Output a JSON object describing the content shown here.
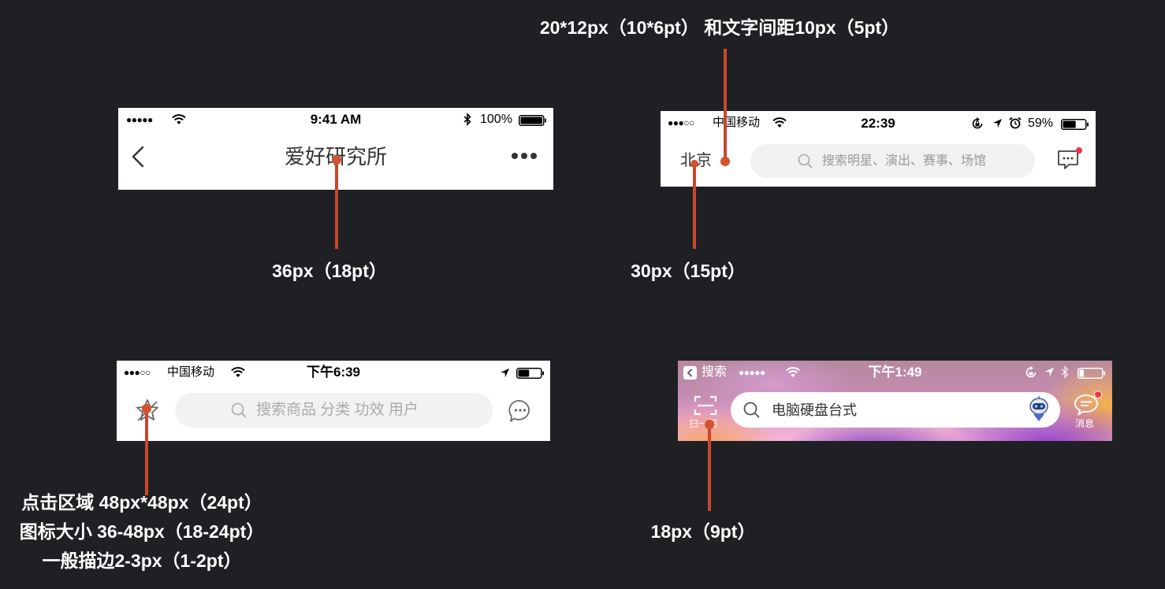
{
  "colors": {
    "background": "#1f2023",
    "annotation": "#c9472d",
    "unread_dot": "#f2334b"
  },
  "annotations": {
    "bar1_title": "36px（18pt）",
    "bar2_top": "20*12px（10*6pt） 和文字间距10px（5pt）",
    "bar2_bottom": "30px（15pt）",
    "bar3_lines": [
      "点击区域 48px*48px（24pt）",
      "图标大小 36-48px（18-24pt）",
      "一般描边2-3px（1-2pt）"
    ],
    "bar4_bottom": "18px（9pt）"
  },
  "bar1": {
    "status": {
      "signal": "●●●●●",
      "time": "9:41 AM",
      "battery_text": "100%",
      "battery_level": 1.0
    },
    "nav": {
      "title": "爱好研究所"
    },
    "icons": [
      "wifi-icon",
      "bluetooth-icon",
      "battery-icon",
      "back-chevron-icon",
      "more-icon"
    ]
  },
  "bar2": {
    "status": {
      "signal": "●●●○○",
      "carrier": "中国移动",
      "time": "22:39",
      "battery_text": "59%",
      "battery_level": 0.59
    },
    "nav": {
      "city": "北京",
      "search_placeholder": "搜索明星、演出、赛事、场馆"
    },
    "icons": [
      "wifi-icon",
      "rotation-lock-icon",
      "location-icon",
      "alarm-icon",
      "battery-icon",
      "search-icon",
      "message-icon"
    ]
  },
  "bar3": {
    "status": {
      "signal": "●●●○○",
      "carrier": "中国移动",
      "time": "下午6:39",
      "battery_level": 0.5
    },
    "nav": {
      "search_placeholder": "搜索商品 分类 功效 用户"
    },
    "icons": [
      "wifi-icon",
      "location-icon",
      "battery-icon",
      "star-icon",
      "search-icon",
      "chat-bubble-icon"
    ]
  },
  "bar4": {
    "status": {
      "back_app": "搜索",
      "signal": "●●●●●",
      "time": "下午1:49",
      "battery_level": 0.2
    },
    "nav": {
      "scan_label": "扫一扫",
      "search_value": "电脑硬盘台式",
      "message_label": "消息"
    },
    "icons": [
      "back-app-icon",
      "wifi-icon",
      "rotation-lock-icon",
      "location-icon",
      "bluetooth-icon",
      "battery-icon",
      "scan-icon",
      "search-icon",
      "robot-icon",
      "message-icon"
    ]
  }
}
